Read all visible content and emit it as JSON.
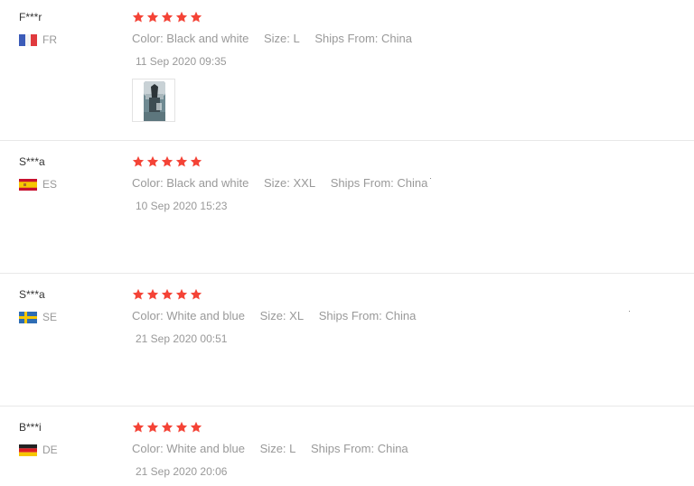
{
  "reviews": [
    {
      "user": "F***r",
      "country": "FR",
      "flag_icon": "france-flag-icon",
      "rating": 5,
      "attributes": [
        "Color: Black and white",
        "Size: L",
        "Ships From: China"
      ],
      "date": "11 Sep 2020 09:35"
    },
    {
      "user": "S***a",
      "country": "ES",
      "flag_icon": "spain-flag-icon",
      "rating": 5,
      "attributes": [
        "Color: Black and white",
        "Size: XXL",
        "Ships From: China"
      ],
      "date": "10 Sep 2020 15:23"
    },
    {
      "user": "S***a",
      "country": "SE",
      "flag_icon": "sweden-flag-icon",
      "rating": 5,
      "attributes": [
        "Color: White and blue",
        "Size: XL",
        "Ships From: China"
      ],
      "date": "21 Sep 2020 00:51"
    },
    {
      "user": "B***i",
      "country": "DE",
      "flag_icon": "germany-flag-icon",
      "rating": 5,
      "attributes": [
        "Color: White and blue",
        "Size: L",
        "Ships From: China"
      ],
      "date": "21 Sep 2020 20:06"
    }
  ],
  "colors": {
    "star": "#f44336",
    "username": "#333333",
    "meta": "#999999",
    "divider": "#e8e8e8"
  }
}
